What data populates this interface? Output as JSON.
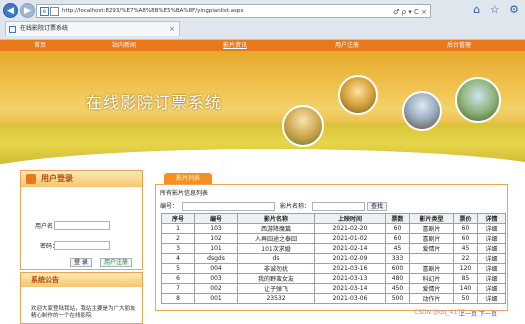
{
  "browser": {
    "url": "http://localhost:8293/%E7%A8%8B%E5%BA%8F/yingpianlist.aspx",
    "tab_title": "在线影院订票系统",
    "tab_close": "×",
    "back_glyph": "◀",
    "forward_glyph": "▶",
    "page_glyph": "e",
    "tools": "♂ ρ ▾ C ×",
    "right_icons": "⌂ ☆ ⚙"
  },
  "nav": {
    "items": [
      "首页",
      "站内新闻",
      "影片资讯",
      "用户注册",
      "后台管理"
    ],
    "active_index": 2
  },
  "banner": {
    "title": "在线影院订票系统"
  },
  "login": {
    "header": "用户登录",
    "username_label": "用户名：",
    "password_label": "密码：",
    "login_button": "登 录",
    "register_button": "用户注册"
  },
  "notice": {
    "header": "系统公告",
    "text": "欢迎大家登陆我站，我站主要是为广大朋友精心制作的一个在线影院"
  },
  "panel": {
    "tab_label": "影片列表",
    "title": "所有影片信息列表",
    "search_code_label": "编号：",
    "search_name_label": "影片名称：",
    "search_button": "查找"
  },
  "table": {
    "headers": [
      "序号",
      "编号",
      "影片名称",
      "上映时间",
      "票数",
      "影片类型",
      "票价",
      "详情"
    ],
    "rows": [
      [
        "1",
        "103",
        "西游降魔篇",
        "2021-02-20",
        "60",
        "喜剧片",
        "60",
        "详细"
      ],
      [
        "2",
        "102",
        "人再囧途之泰囧",
        "2021-01-02",
        "60",
        "喜剧片",
        "60",
        "详细"
      ],
      [
        "3",
        "101",
        "101次求婚",
        "2021-02-14",
        "45",
        "爱情片",
        "45",
        "详细"
      ],
      [
        "4",
        "dsgds",
        "ds",
        "2021-02-09",
        "333",
        "",
        "22",
        "详细"
      ],
      [
        "5",
        "004",
        "非诚勿扰",
        "2021-03-16",
        "600",
        "喜剧片",
        "120",
        "详细"
      ],
      [
        "6",
        "003",
        "我的野蛮女友",
        "2021-03-13",
        "480",
        "科幻片",
        "85",
        "详细"
      ],
      [
        "7",
        "002",
        "让子弹飞",
        "2021-03-14",
        "450",
        "爱情片",
        "140",
        "详细"
      ],
      [
        "8",
        "001",
        "23532",
        "2021-03-06",
        "500",
        "动作片",
        "50",
        "详细"
      ]
    ]
  },
  "pager": {
    "prev": "上一页",
    "next": "下一页"
  },
  "watermark": "CSDN @qq_4177",
  "colors": {
    "nav_orange": "#e8781a",
    "panel_border": "#f4a356",
    "accent": "#f58f1f"
  }
}
